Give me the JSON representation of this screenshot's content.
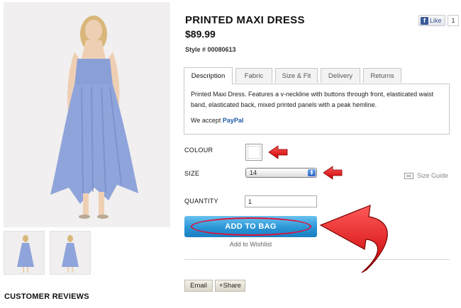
{
  "product": {
    "title": "PRINTED MAXI DRESS",
    "price": "$89.99",
    "style": "Style # 00080613"
  },
  "facebook": {
    "like_label": "Like",
    "count": "1"
  },
  "tabs": [
    {
      "label": "Description",
      "active": true
    },
    {
      "label": "Fabric",
      "active": false
    },
    {
      "label": "Size & Fit",
      "active": false
    },
    {
      "label": "Delivery",
      "active": false
    },
    {
      "label": "Returns",
      "active": false
    }
  ],
  "description": {
    "text": "Printed Maxi Dress. Features a v-neckline with buttons through front, elasticated waist band, elasticated back, mixed printed panels with a peak hemline.",
    "accept_prefix": "We accept",
    "accept_brand": "PayPal"
  },
  "options": {
    "colour_label": "COLOUR",
    "size_label": "SIZE",
    "size_value": "14",
    "size_guide": "Size Guide",
    "quantity_label": "QUANTITY",
    "quantity_value": "1"
  },
  "actions": {
    "add_to_bag": "ADD TO BAG",
    "add_to_wishlist": "Add to Wishlist",
    "email": "Email",
    "share": "+Share"
  },
  "reviews": {
    "title": "CUSTOMER REVIEWS"
  },
  "colors": {
    "accent_blue": "#2a95d6",
    "highlight_red": "#e0103a",
    "dress_blue": "#8a9fd6"
  }
}
